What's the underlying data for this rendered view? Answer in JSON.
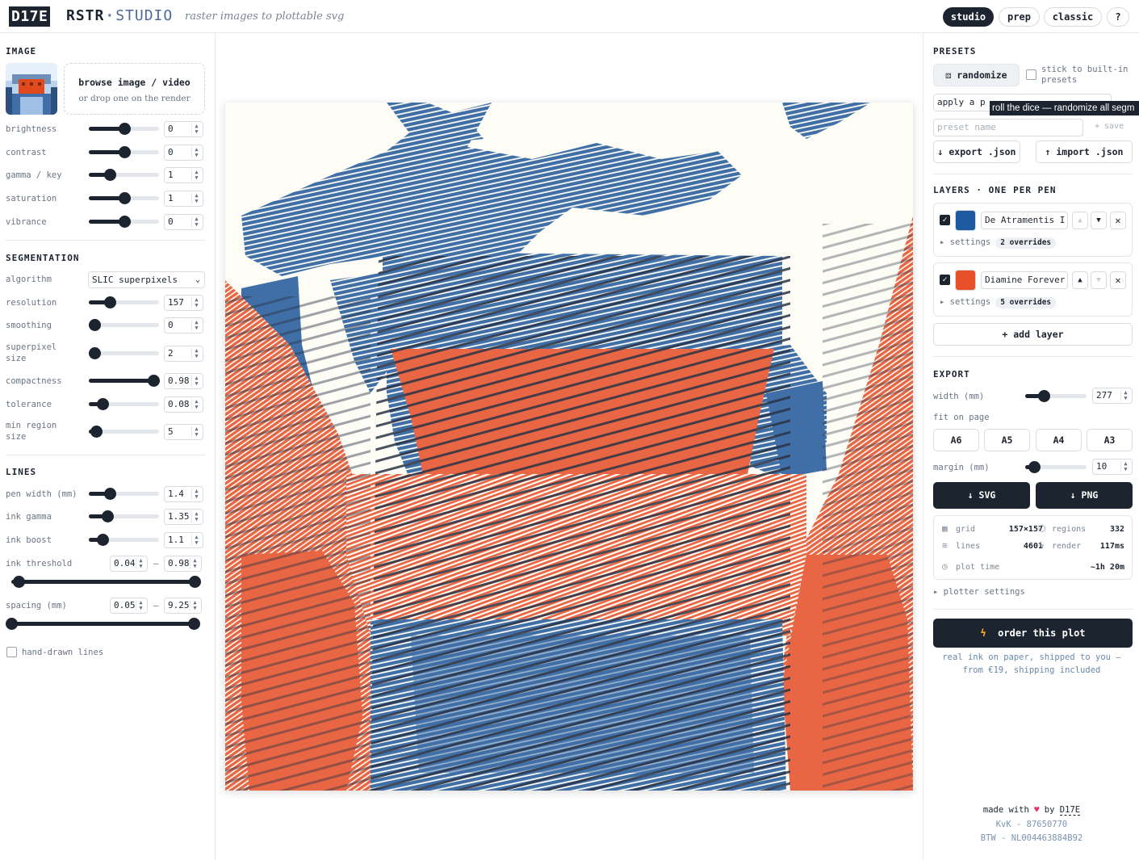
{
  "header": {
    "logo": "D17E",
    "brand_main": "RSTR",
    "brand_dot": "·",
    "brand_sub": "STUDIO",
    "tagline": "raster images to plottable svg",
    "nav": [
      "studio",
      "prep",
      "classic",
      "?"
    ]
  },
  "image": {
    "title": "IMAGE",
    "browse": "browse image / video",
    "drop_hint": "or drop one on the render",
    "controls": [
      {
        "label": "brightness",
        "value": "0",
        "level": 0.5
      },
      {
        "label": "contrast",
        "value": "0",
        "level": 0.5
      },
      {
        "label": "gamma / key",
        "value": "1",
        "level": 0.3
      },
      {
        "label": "saturation",
        "value": "1",
        "level": 0.5
      },
      {
        "label": "vibrance",
        "value": "0",
        "level": 0.5
      }
    ]
  },
  "segmentation": {
    "title": "SEGMENTATION",
    "algorithm_label": "algorithm",
    "algorithm_value": "SLIC superpixels",
    "controls": [
      {
        "label": "resolution",
        "value": "157",
        "level": 0.3
      },
      {
        "label": "smoothing",
        "value": "0",
        "level": 0.08
      },
      {
        "label": "superpixel size",
        "value": "2",
        "level": 0.08
      },
      {
        "label": "compactness",
        "value": "0.98",
        "level": 0.92
      },
      {
        "label": "tolerance",
        "value": "0.08",
        "level": 0.2
      },
      {
        "label": "min region size",
        "value": "5",
        "level": 0.1
      }
    ]
  },
  "lines": {
    "title": "LINES",
    "controls": [
      {
        "label": "pen width (mm)",
        "value": "1.4",
        "level": 0.3
      },
      {
        "label": "ink gamma",
        "value": "1.35",
        "level": 0.27
      },
      {
        "label": "ink boost",
        "value": "1.1",
        "level": 0.2
      }
    ],
    "ink_threshold": {
      "label": "ink threshold",
      "min": "0.04",
      "max": "0.98",
      "sep": "–"
    },
    "spacing": {
      "label": "spacing (mm)",
      "min": "0.05",
      "max": "9.25",
      "sep": "–"
    },
    "hand_drawn": "hand-drawn lines"
  },
  "presets": {
    "title": "PRESETS",
    "randomize": "randomize",
    "stick": "stick to built-in presets",
    "apply_placeholder": "apply a p",
    "tooltip": "roll the dice — randomize all segm",
    "name_placeholder": "preset name",
    "save": "+ save",
    "export": "↓ export .json",
    "import": "↑ import .json"
  },
  "layers": {
    "title": "LAYERS · ONE PER PEN",
    "items": [
      {
        "pen": "De Atramentis I",
        "color": "#1e5aa0",
        "settings": "settings",
        "overrides": "2 overrides"
      },
      {
        "pen": "Diamine Forever",
        "color": "#e8502a",
        "settings": "settings",
        "overrides": "5 overrides"
      }
    ],
    "add": "+ add layer"
  },
  "export": {
    "title": "EXPORT",
    "width_label": "width (mm)",
    "width_value": "277",
    "width_level": 0.3,
    "fit_label": "fit on page",
    "pages": [
      "A6",
      "A5",
      "A4",
      "A3"
    ],
    "margin_label": "margin (mm)",
    "margin_value": "10",
    "margin_level": 0.15,
    "svg": "↓ SVG",
    "png": "↓ PNG"
  },
  "stats": {
    "grid_label": "grid",
    "grid": "157×157",
    "regions_label": "regions",
    "regions": "332",
    "lines_label": "lines",
    "lines": "4601",
    "render_label": "render",
    "render": "117ms",
    "plot_label": "plot time",
    "plot": "~1h 20m"
  },
  "plotter_settings": "plotter settings",
  "order": {
    "button": "order this plot",
    "note1": "real ink on paper, shipped to you —",
    "note2": "from €19, shipping included"
  },
  "footer": {
    "made_pre": "made with",
    "heart": "♥",
    "made_post": "by",
    "made_link": "D17E",
    "kvk": "KvK - 87650770",
    "btw": "BTW - NL004463884B92"
  },
  "colors": {
    "ink": "#1c2430",
    "blue": "#3f6fa6",
    "orange": "#e86644",
    "paper": "#fdfcf5",
    "stripe_dark": "#2a3345"
  }
}
